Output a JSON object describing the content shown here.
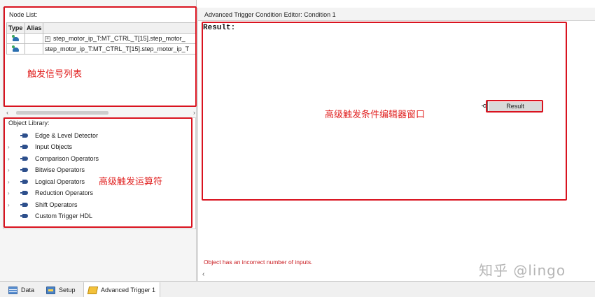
{
  "node_list": {
    "title": "Node List:",
    "columns": [
      "Type",
      "Alias"
    ],
    "rows": [
      {
        "expander": "+",
        "name": "step_motor_ip_T:MT_CTRL_T[15].step_motor_"
      },
      {
        "expander": "",
        "name": "step_motor_ip_T:MT_CTRL_T[15].step_motor_ip_T"
      }
    ],
    "annotation": "触发信号列表"
  },
  "object_library": {
    "title": "Object Library:",
    "items": [
      {
        "label": "Edge & Level Detector",
        "expandable": false
      },
      {
        "label": "Input Objects",
        "expandable": true
      },
      {
        "label": "Comparison Operators",
        "expandable": true
      },
      {
        "label": "Bitwise Operators",
        "expandable": true
      },
      {
        "label": "Logical Operators",
        "expandable": true
      },
      {
        "label": "Reduction Operators",
        "expandable": true
      },
      {
        "label": "Shift Operators",
        "expandable": true
      },
      {
        "label": "Custom Trigger HDL",
        "expandable": false
      }
    ],
    "annotation": "高级触发运算符"
  },
  "editor": {
    "title": "Advanced Trigger Condition Editor: Condition 1",
    "result_label": "Result:",
    "result_node": "Result",
    "annotation": "高级触发条件编辑器窗口",
    "error": "Object has an incorrect number of inputs."
  },
  "tabs": [
    {
      "label": "Data",
      "icon": "data-icon"
    },
    {
      "label": "Setup",
      "icon": "setup-icon"
    },
    {
      "label": "Advanced Trigger 1",
      "icon": "trigger-icon",
      "active": true
    }
  ],
  "watermark": "知乎 @lingo",
  "colors": {
    "annotation_red": "#e0201f",
    "error_red": "#c8191e",
    "library_icon_blue": "#2d4f8c"
  }
}
